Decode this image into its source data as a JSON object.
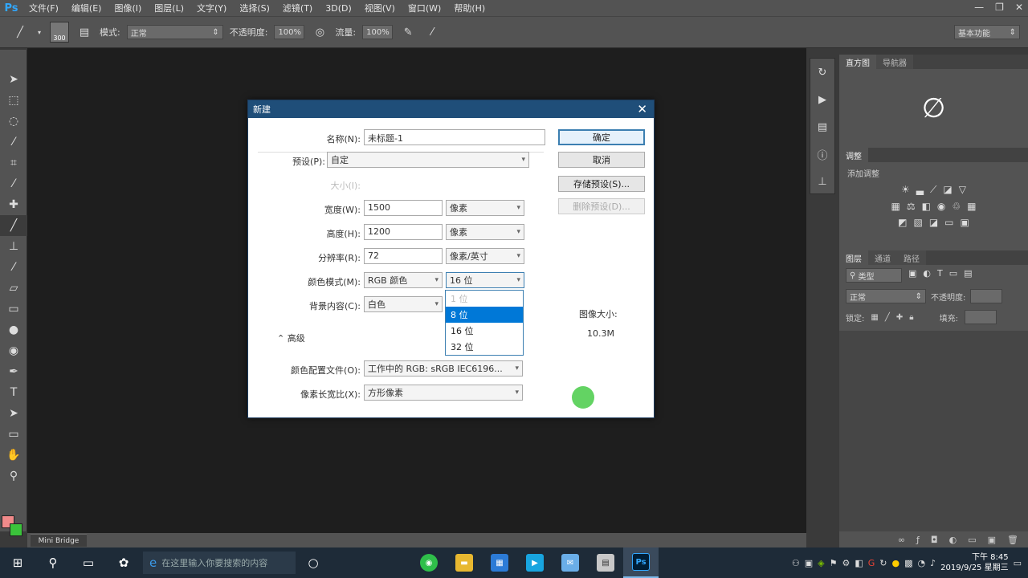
{
  "app": {
    "logo": "Ps"
  },
  "menu": [
    "文件(F)",
    "编辑(E)",
    "图像(I)",
    "图层(L)",
    "文字(Y)",
    "选择(S)",
    "滤镜(T)",
    "3D(D)",
    "视图(V)",
    "窗口(W)",
    "帮助(H)"
  ],
  "options": {
    "brush_size": "300",
    "mode_label": "模式:",
    "mode_value": "正常",
    "opacity_label": "不透明度:",
    "opacity_value": "100%",
    "flow_label": "流量:",
    "flow_value": "100%",
    "workspace": "基本功能"
  },
  "panels": {
    "tabs_top": [
      "直方图",
      "导航器"
    ],
    "tabs_adj": [
      "调整"
    ],
    "adj_title": "添加调整",
    "tabs_layers": [
      "图层",
      "通道",
      "路径"
    ],
    "layer_filter": "类型",
    "blend_mode": "正常",
    "opacity_label": "不透明度:",
    "lock_label": "锁定:",
    "fill_label": "填充:"
  },
  "dialog": {
    "title": "新建",
    "name_label": "名称(N):",
    "name_value": "未标题-1",
    "preset_label": "预设(P):",
    "preset_value": "自定",
    "size_label": "大小(I):",
    "width_label": "宽度(W):",
    "width_value": "1500",
    "width_unit": "像素",
    "height_label": "高度(H):",
    "height_value": "1200",
    "height_unit": "像素",
    "res_label": "分辨率(R):",
    "res_value": "72",
    "res_unit": "像素/英寸",
    "color_mode_label": "颜色模式(M):",
    "color_mode_value": "RGB 颜色",
    "bit_depth_value": "16 位",
    "bg_label": "背景内容(C):",
    "bg_value": "白色",
    "advanced_label": "高级",
    "profile_label": "颜色配置文件(O):",
    "profile_value": "工作中的 RGB: sRGB IEC6196...",
    "pixel_aspect_label": "像素长宽比(X):",
    "pixel_aspect_value": "方形像素",
    "ok_btn": "确定",
    "cancel_btn": "取消",
    "save_preset_btn": "存储预设(S)...",
    "delete_preset_btn": "删除预设(D)...",
    "image_size_label": "图像大小:",
    "image_size_value": "10.3M",
    "dropdown_options": [
      "1 位",
      "8 位",
      "16 位",
      "32 位"
    ]
  },
  "mini_bridge": "Mini Bridge",
  "taskbar": {
    "search_placeholder": "在这里输入你要搜索的内容",
    "time": "下午 8:45",
    "date": "2019/9/25 星期三"
  }
}
